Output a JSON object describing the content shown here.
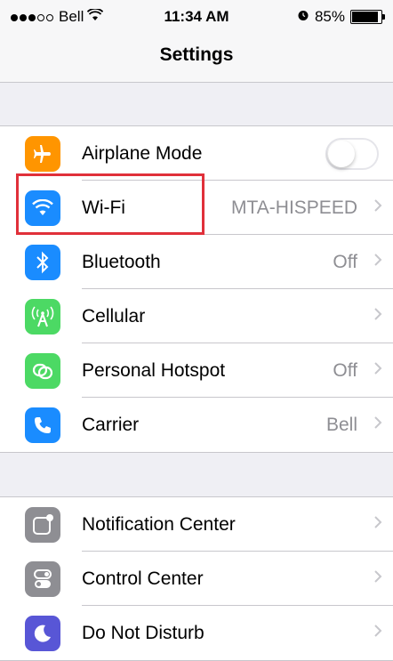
{
  "status_bar": {
    "carrier": "Bell",
    "signal": "●●●○○",
    "time": "11:34 AM",
    "battery": "85%",
    "battery_level": 0.85
  },
  "nav": {
    "title": "Settings"
  },
  "group1": [
    {
      "label": "Airplane Mode",
      "value": "",
      "icon": "airplane-icon",
      "color": "#ff9500",
      "control": "toggle-off"
    },
    {
      "label": "Wi-Fi",
      "value": "MTA-HISPEED",
      "icon": "wifi-icon",
      "color": "#1a8cff",
      "highlighted": true
    },
    {
      "label": "Bluetooth",
      "value": "Off",
      "icon": "bluetooth-icon",
      "color": "#1a8cff"
    },
    {
      "label": "Cellular",
      "value": "",
      "icon": "cellular-icon",
      "color": "#4cd964"
    },
    {
      "label": "Personal Hotspot",
      "value": "Off",
      "icon": "hotspot-icon",
      "color": "#4cd964"
    },
    {
      "label": "Carrier",
      "value": "Bell",
      "icon": "phone-icon",
      "color": "#1a8cff"
    }
  ],
  "group2": [
    {
      "label": "Notification Center",
      "value": "",
      "icon": "notification-center-icon",
      "color": "#8e8e93"
    },
    {
      "label": "Control Center",
      "value": "",
      "icon": "control-center-icon",
      "color": "#8e8e93"
    },
    {
      "label": "Do Not Disturb",
      "value": "",
      "icon": "moon-icon",
      "color": "#5856d6"
    }
  ],
  "highlight_color": "#e0303a"
}
